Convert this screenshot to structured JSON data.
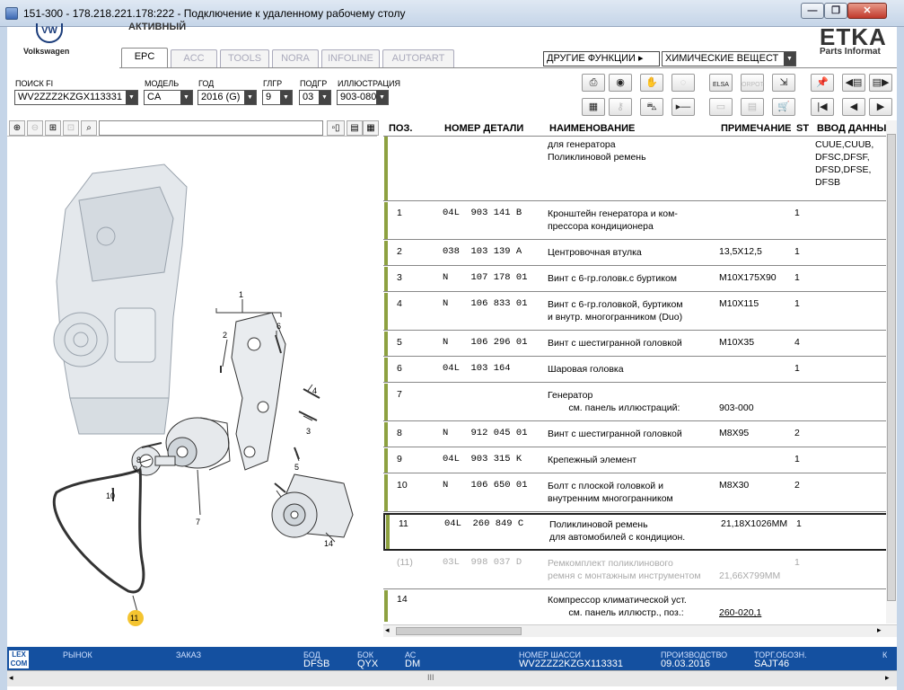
{
  "window": {
    "title": "151-300 - 178.218.221.178:222 - Подключение к удаленному рабочему столу",
    "minimize": "—",
    "maximize": "❐",
    "close": "✕"
  },
  "header": {
    "brand_logo": "VW",
    "brand_name": "Volkswagen",
    "active_label": "АКТИВНЫЙ",
    "product_logo": "ETKA",
    "product_sub": "Parts Informat"
  },
  "tabs": [
    {
      "label": "EPC",
      "active": true
    },
    {
      "label": "ACC",
      "active": false
    },
    {
      "label": "TOOLS",
      "active": false
    },
    {
      "label": "NORA",
      "active": false
    },
    {
      "label": "INFOLINE",
      "active": false
    },
    {
      "label": "AUTOPART",
      "active": false
    }
  ],
  "menus": {
    "other_functions": "ДРУГИЕ ФУНКЦИИ ▸",
    "chemicals": "ХИМИЧЕСКИЕ ВЕЩЕСТ"
  },
  "filters": {
    "search_fi": {
      "label": "ПОИСК FI",
      "value": "WV2ZZZ2KZGX113331"
    },
    "model": {
      "label": "МОДЕЛЬ",
      "value": "CA"
    },
    "year": {
      "label": "ГОД",
      "value": "2016 (G)"
    },
    "main_group": {
      "label": "ГЛГР",
      "value": "9"
    },
    "sub_group": {
      "label": "ПОДГР",
      "value": "03"
    },
    "illustration": {
      "label": "ИЛЛЮСТРАЦИЯ",
      "value": "903-080"
    }
  },
  "toolbar_icons": [
    "print-icon",
    "camera-icon",
    "hands-icon",
    "sketch-icon",
    "elsa-icon",
    "orpot-icon",
    "cart-arrow-icon",
    "pin-icon",
    "prev-page-icon",
    "next-page-icon",
    "keyboard-icon",
    "key-icon",
    "car-icon",
    "arrow-icon",
    "window-icon",
    "document-icon",
    "cart-icon",
    "first-icon",
    "previous-icon",
    "next-icon"
  ],
  "toolbar_text": {
    "elsa": "ELSA",
    "orpot": "ORPOT"
  },
  "table": {
    "headers": {
      "pos": "ПОЗ.",
      "part_number": "НОМЕР ДЕТАЛИ",
      "name": "НАИМЕНОВАНИЕ",
      "note": "ПРИМЕЧАНИЕ",
      "st": "ST",
      "input_data": "ВВОД ДАННЫХ"
    },
    "rows": [
      {
        "pos": "",
        "number": "",
        "name": "для генератора\nПоликлиновой ремень",
        "note": "",
        "st": "",
        "input": "CUUE,CUUB,\nDFSC,DFSF,\nDFSD,DFSE,\nDFSB"
      },
      {
        "pos": "1",
        "number": "04L  903 141 B",
        "name": "Кронштейн генератора и ком-\nпрессора кондиционера",
        "note": "",
        "st": "1",
        "input": ""
      },
      {
        "pos": "2",
        "number": "038  103 139 A",
        "name": "Центровочная втулка",
        "note": "13,5X12,5",
        "st": "1",
        "input": ""
      },
      {
        "pos": "3",
        "number": "N    107 178 01",
        "name": "Винт с 6-гр.головк.с буртиком",
        "note": "M10X175X90",
        "st": "1",
        "input": ""
      },
      {
        "pos": "4",
        "number": "N    106 833 01",
        "name": "Винт с 6-гр.головкой, буртиком\nи внутр. многогранником (Duo)",
        "note": "M10X115",
        "st": "1",
        "input": ""
      },
      {
        "pos": "5",
        "number": "N    106 296 01",
        "name": "Винт с шестигранной головкой",
        "note": "M10X35",
        "st": "4",
        "input": ""
      },
      {
        "pos": "6",
        "number": "04L  103 164",
        "name": "Шаровая головка",
        "note": "",
        "st": "1",
        "input": ""
      },
      {
        "pos": "7",
        "number": "",
        "name": "Генератор\n        см. панель иллюстраций:",
        "note": "\n903-000",
        "st": "",
        "input": ""
      },
      {
        "pos": "8",
        "number": "N    912 045 01",
        "name": "Винт с шестигранной головкой",
        "note": "M8X95",
        "st": "2",
        "input": ""
      },
      {
        "pos": "9",
        "number": "04L  903 315 K",
        "name": "Крепежный элемент",
        "note": "",
        "st": "1",
        "input": ""
      },
      {
        "pos": "10",
        "number": "N    106 650 01",
        "name": "Болт с плоской головкой и\nвнутренним многогранником",
        "note": "M8X30",
        "st": "2",
        "input": ""
      },
      {
        "pos": "11",
        "number": "04L  260 849 C",
        "name": "Поликлиновой ремень\nдля автомобилей с кондицион.",
        "note": "21,18X1026MM",
        "st": "1",
        "input": ""
      },
      {
        "pos": "(11)",
        "number": "03L  998 037 D",
        "name": "Ремкомплект поликлинового\nремня с монтажным инструментом",
        "note": "\n21,66X799MM",
        "st": "1",
        "input": ""
      },
      {
        "pos": "14",
        "number": "",
        "name": "Компрессор климатической уст.\n        см. панель иллюстр., поз.:",
        "note": "\n260-020,1",
        "st": "",
        "input": ""
      }
    ]
  },
  "illustration_callouts": [
    "1",
    "2",
    "3",
    "4",
    "5",
    "6",
    "7",
    "8",
    "9",
    "10",
    "11",
    "14"
  ],
  "status": {
    "logo": "LEX\nCOM",
    "market": {
      "label": "РЫНОК",
      "value": ""
    },
    "order": {
      "label": "ЗАКАЗ",
      "value": ""
    },
    "bod": {
      "label": "БОД",
      "value": "DFSB"
    },
    "bok": {
      "label": "БОК",
      "value": "QYX"
    },
    "ac": {
      "label": "АС",
      "value": "DM"
    },
    "chassis": {
      "label": "НОМЕР ШАССИ",
      "value": "WV2ZZZ2KZGX113331"
    },
    "production": {
      "label": "ПРОИЗВОДСТВО",
      "value": "09.03.2016"
    },
    "trade": {
      "label": "ТОРГ.ОБОЗН.",
      "value": "SAJT46"
    },
    "k": {
      "label": "К",
      "value": ""
    }
  },
  "bottom_scroll_grip": "III",
  "colors": {
    "accent_bar": "#8da140",
    "status_bar": "#1450a0",
    "callout_highlight": "#f4c430"
  }
}
